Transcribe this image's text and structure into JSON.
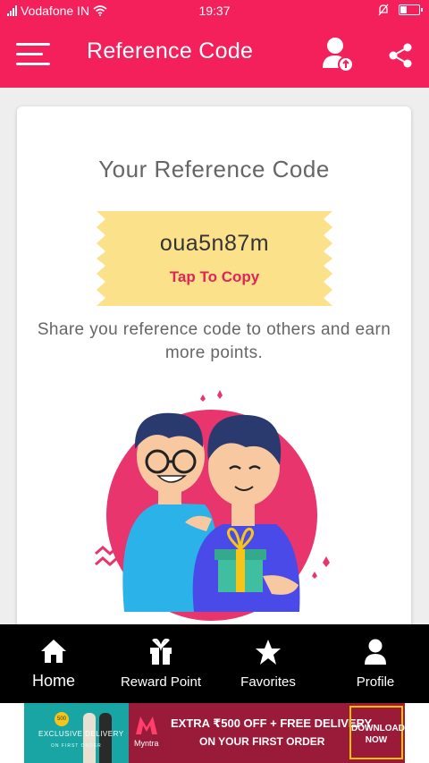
{
  "status_bar": {
    "carrier": "Vodafone IN",
    "time": "19:37",
    "battery_level": 0.3
  },
  "app_bar": {
    "title": "Reference Code",
    "menu_icon": "hamburger-menu-icon",
    "user_icon": "user-upload-icon",
    "share_icon": "share-icon"
  },
  "card": {
    "heading": "Your Reference Code",
    "code": "oua5n87m",
    "tap_to_copy": "Tap To Copy",
    "share_text": "Share you reference code to others and earn more points."
  },
  "bottom_nav": {
    "items": [
      {
        "label": "Home",
        "icon": "home-icon",
        "active": true
      },
      {
        "label": "Reward Point",
        "icon": "gift-icon",
        "active": false
      },
      {
        "label": "Favorites",
        "icon": "star-icon",
        "active": false
      },
      {
        "label": "Profile",
        "icon": "person-icon",
        "active": false
      }
    ]
  },
  "ad": {
    "badge": "500",
    "left_text": "EXCLUSIVE DELIVERY",
    "left_sub": "ON FIRST ORDER",
    "brand": "Myntra",
    "line1": "EXTRA ₹500 OFF + FREE DELIVERY",
    "line2": "ON YOUR FIRST ORDER",
    "cta": "DOWNLOAD NOW"
  },
  "colors": {
    "primary": "#f4205c",
    "ticket": "#fbe18a",
    "accent_text": "#e0245a",
    "nav_bg": "#000000"
  }
}
